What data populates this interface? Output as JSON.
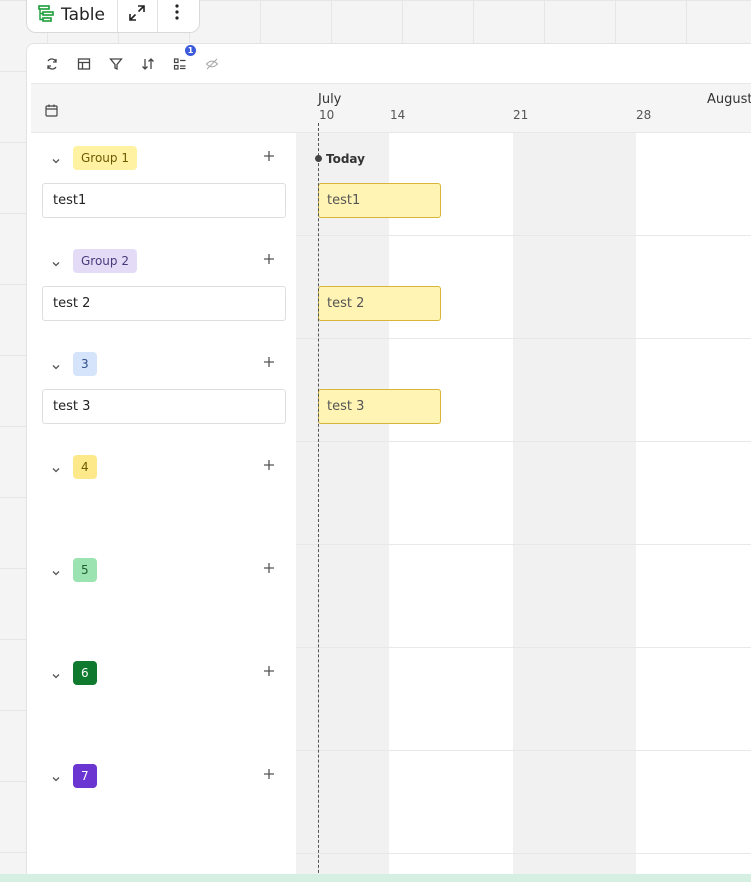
{
  "top_toolbar": {
    "title": "Table"
  },
  "view_toolbar": {
    "filter_badge": "1"
  },
  "timeline": {
    "months": [
      {
        "label": "July"
      },
      {
        "label": "August"
      }
    ],
    "days": [
      "10",
      "14",
      "21",
      "28"
    ],
    "today_label": "Today"
  },
  "groups": [
    {
      "tag": "Group 1",
      "tag_bg": "#fff3a3",
      "tag_color": "#6b5a00",
      "item": "test1",
      "bar": "test1"
    },
    {
      "tag": "Group 2",
      "tag_bg": "#e4dcf7",
      "tag_color": "#4a3a7a",
      "item": "test 2",
      "bar": "test 2"
    },
    {
      "tag": "3",
      "tag_bg": "#d6e4fb",
      "tag_color": "#2f4f8a",
      "item": "test 3",
      "bar": "test 3"
    },
    {
      "tag": "4",
      "tag_bg": "#fde98a",
      "tag_color": "#6b5a00"
    },
    {
      "tag": "5",
      "tag_bg": "#9be3b0",
      "tag_color": "#1f5e33"
    },
    {
      "tag": "6",
      "tag_bg": "#0f7a2e",
      "tag_color": "#ffffff"
    },
    {
      "tag": "7",
      "tag_bg": "#6a35d1",
      "tag_color": "#ffffff"
    }
  ],
  "colors": {
    "bar_fill": "#fff4b3",
    "bar_border": "#d9b43b",
    "badge": "#3b5bdb"
  }
}
